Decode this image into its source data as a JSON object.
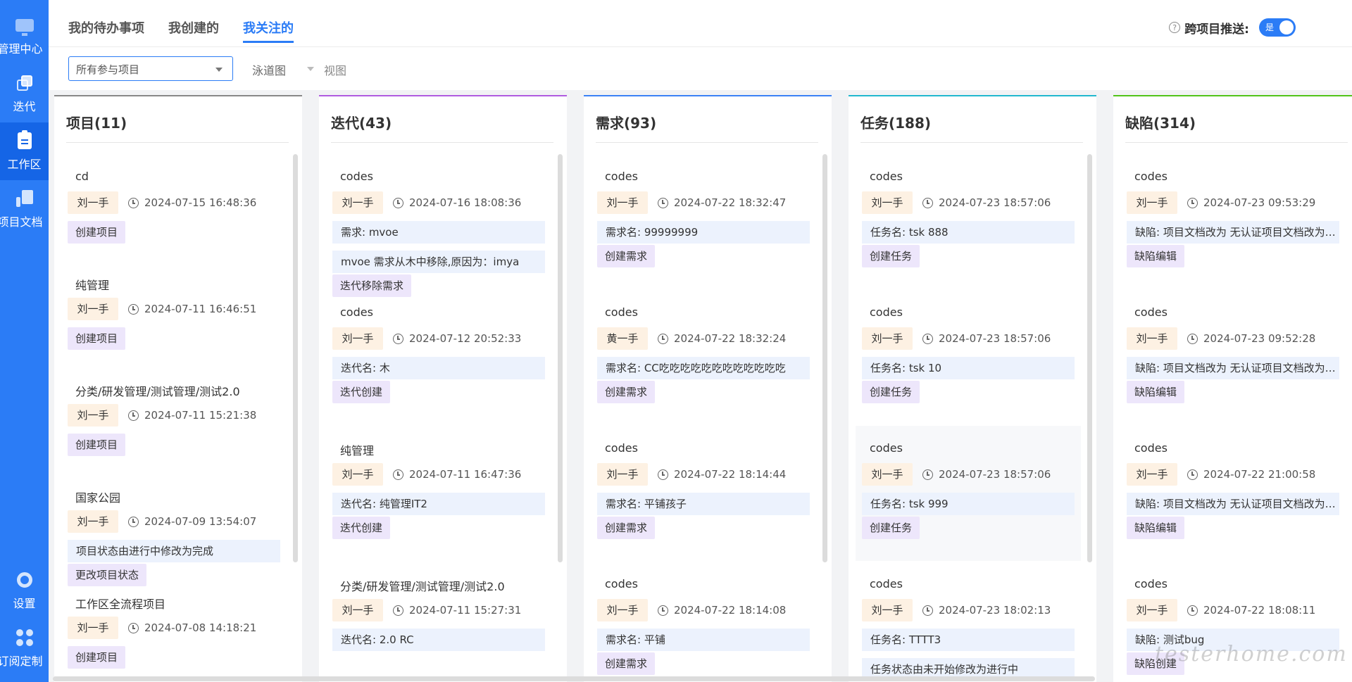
{
  "sidebar": {
    "items": [
      {
        "label": "管理中心",
        "icon": "monitor-icon"
      },
      {
        "label": "迭代",
        "icon": "layers-icon"
      },
      {
        "label": "工作区",
        "icon": "clipboard-icon",
        "active": true
      },
      {
        "label": "项目文档",
        "icon": "document-icon"
      },
      {
        "label": "设置",
        "icon": "gear-icon"
      },
      {
        "label": "订阅定制",
        "icon": "grid-icon"
      }
    ]
  },
  "tabs": [
    {
      "label": "我的待办事项"
    },
    {
      "label": "我创建的"
    },
    {
      "label": "我关注的",
      "active": true
    }
  ],
  "cross_push": {
    "label": "跨项目推送:",
    "toggle_label": "是",
    "help": "?"
  },
  "filters": {
    "project_select": "所有参与项目",
    "lane_view": "泳道图",
    "view": "视图"
  },
  "accent_color": "#2b7cf6",
  "columns": [
    {
      "title": "项目(11)",
      "color": "#888888",
      "cards": [
        {
          "title": "cd",
          "user": "刘一手",
          "time": "2024-07-15 16:48:36",
          "details": [],
          "action": "创建项目"
        },
        {
          "title": "纯管理",
          "user": "刘一手",
          "time": "2024-07-11 16:46:51",
          "details": [],
          "action": "创建项目"
        },
        {
          "title": "分类/研发管理/测试管理/测试2.0",
          "user": "刘一手",
          "time": "2024-07-11 15:21:38",
          "details": [],
          "action": "创建项目"
        },
        {
          "title": "国家公园",
          "user": "刘一手",
          "time": "2024-07-09 13:54:07",
          "details": [
            "项目状态由进行中修改为完成"
          ],
          "action": "更改项目状态"
        },
        {
          "title": "工作区全流程项目",
          "user": "刘一手",
          "time": "2024-07-08 14:18:21",
          "details": [],
          "action": "创建项目"
        }
      ]
    },
    {
      "title": "迭代(43)",
      "color": "#b05ce0",
      "cards": [
        {
          "title": "codes",
          "user": "刘一手",
          "time": "2024-07-16 18:08:36",
          "details": [
            "需求: mvoe",
            "mvoe 需求从木中移除,原因为：imya"
          ],
          "action": "迭代移除需求"
        },
        {
          "title": "codes",
          "user": "刘一手",
          "time": "2024-07-12 20:52:33",
          "details": [
            "迭代名: 木"
          ],
          "action": "迭代创建"
        },
        {
          "title": "纯管理",
          "user": "刘一手",
          "time": "2024-07-11 16:47:36",
          "details": [
            "迭代名: 纯管理IT2"
          ],
          "action": "迭代创建"
        },
        {
          "title": "分类/研发管理/测试管理/测试2.0",
          "user": "刘一手",
          "time": "2024-07-11 15:27:31",
          "details": [
            "迭代名: 2.0 RC"
          ],
          "action": ""
        }
      ]
    },
    {
      "title": "需求(93)",
      "color": "#3b82f6",
      "cards": [
        {
          "title": "codes",
          "user": "刘一手",
          "time": "2024-07-22 18:32:47",
          "details": [
            "需求名: 99999999"
          ],
          "action": "创建需求"
        },
        {
          "title": "codes",
          "user": "黄一手",
          "time": "2024-07-22 18:32:24",
          "details": [
            "需求名: CC吃吃吃吃吃吃吃吃吃吃吃吃"
          ],
          "action": "创建需求"
        },
        {
          "title": "codes",
          "user": "刘一手",
          "time": "2024-07-22 18:14:44",
          "details": [
            "需求名: 平铺孩子"
          ],
          "action": "创建需求"
        },
        {
          "title": "codes",
          "user": "刘一手",
          "time": "2024-07-22 18:14:08",
          "details": [
            "需求名: 平铺"
          ],
          "action": "创建需求"
        }
      ]
    },
    {
      "title": "任务(188)",
      "color": "#22b8cf",
      "cards": [
        {
          "title": "codes",
          "user": "刘一手",
          "time": "2024-07-23 18:57:06",
          "details": [
            "任务名: tsk 888"
          ],
          "action": "创建任务"
        },
        {
          "title": "codes",
          "user": "刘一手",
          "time": "2024-07-23 18:57:06",
          "details": [
            "任务名: tsk 10"
          ],
          "action": "创建任务"
        },
        {
          "title": "codes",
          "user": "刘一手",
          "time": "2024-07-23 18:57:06",
          "details": [
            "任务名: tsk 999"
          ],
          "action": "创建任务",
          "highlighted": true
        },
        {
          "title": "codes",
          "user": "刘一手",
          "time": "2024-07-23 18:02:13",
          "details": [
            "任务名: TTTT3",
            "任务状态由未开始修改为进行中"
          ],
          "action": ""
        }
      ]
    },
    {
      "title": "缺陷(314)",
      "color": "#52c41a",
      "cards": [
        {
          "title": "codes",
          "user": "刘一手",
          "time": "2024-07-23 09:53:29",
          "details": [
            "缺陷: 项目文档改为 无认证项目文档改为无认证"
          ],
          "action": "缺陷编辑"
        },
        {
          "title": "codes",
          "user": "刘一手",
          "time": "2024-07-23 09:52:28",
          "details": [
            "缺陷: 项目文档改为 无认证项目文档改为无认证"
          ],
          "action": "缺陷编辑"
        },
        {
          "title": "codes",
          "user": "刘一手",
          "time": "2024-07-22 21:00:58",
          "details": [
            "缺陷: 项目文档改为 无认证项目文档改为无认证"
          ],
          "action": "缺陷编辑"
        },
        {
          "title": "codes",
          "user": "刘一手",
          "time": "2024-07-22 18:08:11",
          "details": [
            "缺陷: 测试bug"
          ],
          "action": "缺陷创建"
        }
      ]
    }
  ],
  "watermark": "testerhome.com"
}
